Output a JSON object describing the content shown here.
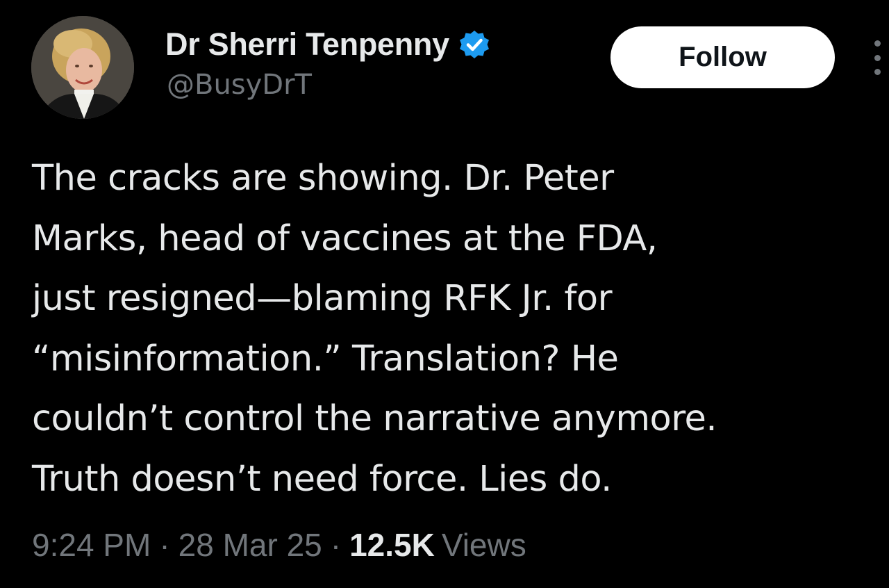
{
  "author": {
    "display_name": "Dr Sherri Tenpenny",
    "handle": "@BusyDrT",
    "verified": true,
    "avatar": "profile-photo"
  },
  "actions": {
    "follow_label": "Follow",
    "more_icon": "more-vertical-icon"
  },
  "tweet": {
    "text_lines": [
      "The cracks are showing. Dr. Peter",
      "Marks, head of vaccines at the FDA,",
      "just resigned—blaming RFK Jr. for",
      "“misinformation.” Translation? He",
      "couldn’t control the narrative anymore.",
      "Truth doesn’t need force. Lies do."
    ]
  },
  "meta": {
    "time": "9:24 PM",
    "separator": "·",
    "date": "28 Mar 25",
    "views_count": "12.5K",
    "views_label": "Views"
  },
  "colors": {
    "background": "#000000",
    "primary_text": "#e7e9ea",
    "secondary_text": "#71767b",
    "verified_blue": "#1d9bf0",
    "follow_button_bg": "#ffffff"
  }
}
